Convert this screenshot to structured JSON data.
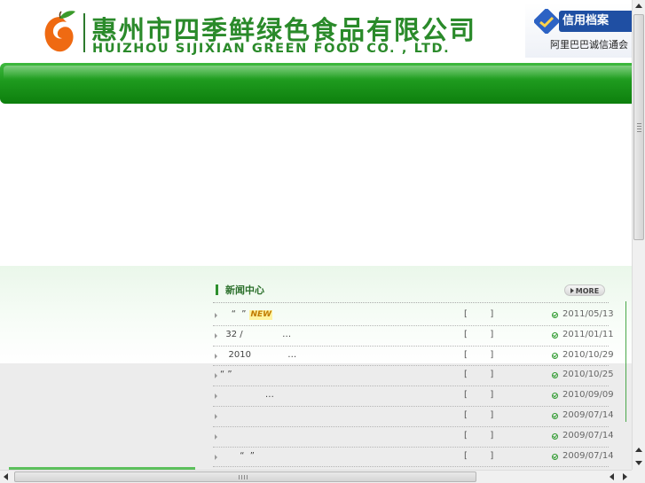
{
  "header": {
    "company_name_cn": "惠州市四季鲜绿色食品有限公司",
    "company_name_en": "HUIZHOU SIJIXIAN GREEN FOOD CO. , LTD.",
    "logo_icon": "orange-fruit-logo",
    "credit_badge": {
      "title": "信用档案",
      "subtitle": "阿里巴巴诚信通会",
      "icon": "alibaba-handshake-icon"
    }
  },
  "colors": {
    "brand_green": "#2a8a2a",
    "nav_green": "#1e9a1e",
    "credit_blue": "#1f4fa3",
    "new_badge": "#c07a00"
  },
  "news": {
    "title": "新闻中心",
    "more_label": "MORE",
    "items": [
      {
        "title": "    “  ”",
        "new_badge": "NEW",
        "category": "[        ]",
        "date": "2011/05/13"
      },
      {
        "title": "  32 /              …",
        "category": "[        ]",
        "date": "2011/01/11"
      },
      {
        "title": "   2010             …",
        "category": "[        ]",
        "date": "2010/10/29"
      },
      {
        "title": "“ ”",
        "category": "[        ]",
        "date": "2010/10/25"
      },
      {
        "title": "                …",
        "category": "[        ]",
        "date": "2010/09/09"
      },
      {
        "title": "",
        "category": "[        ]",
        "date": "2009/07/14"
      },
      {
        "title": "",
        "category": "[        ]",
        "date": "2009/07/14"
      },
      {
        "title": "       “  ”",
        "category": "[        ]",
        "date": "2009/07/14"
      }
    ]
  }
}
